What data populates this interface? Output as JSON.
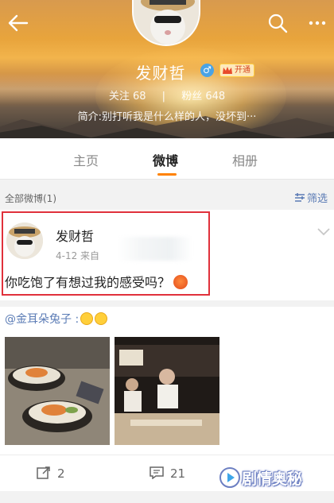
{
  "header": {
    "profile_name": "发财哲",
    "gender_symbol": "♂",
    "vip_label": "开通",
    "stats": {
      "following": "关注 68",
      "followers": "粉丝 648"
    },
    "bio": "简介:别打听我是什么样的人，没坏到···"
  },
  "tabs": [
    {
      "label": "主页"
    },
    {
      "label": "微博"
    },
    {
      "label": "相册"
    }
  ],
  "filterbar": {
    "label": "全部微博(1)",
    "filter_label": "筛选"
  },
  "post": {
    "author": "发财哲",
    "meta": "4-12  来自",
    "text": "你吃饱了有想过我的感受吗？",
    "repost_text": "@金耳朵兔子 :"
  },
  "actions": {
    "repost_count": "2",
    "comment_count": "21"
  },
  "watermark": {
    "text": "剧情奥秘"
  },
  "colors": {
    "accent": "#ff8200",
    "link": "#5a7bb5",
    "highlight": "#e0313b"
  }
}
